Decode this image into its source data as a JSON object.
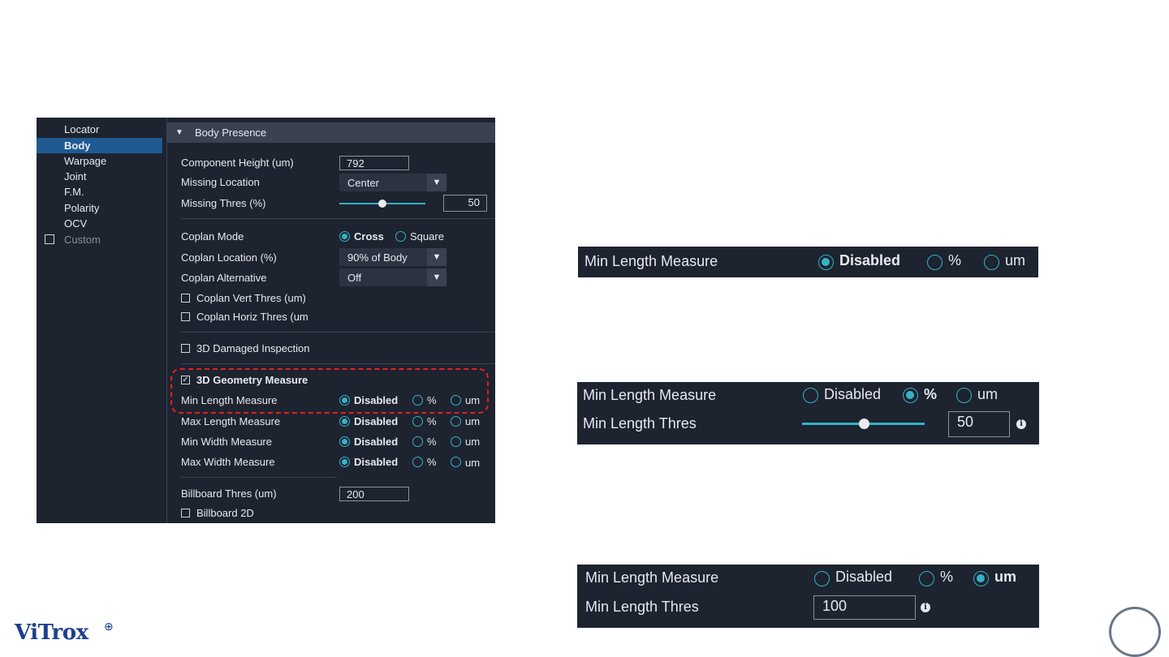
{
  "sidebar": {
    "items": [
      {
        "label": "Locator"
      },
      {
        "label": "Body"
      },
      {
        "label": "Warpage"
      },
      {
        "label": "Joint"
      },
      {
        "label": "F.M."
      },
      {
        "label": "Polarity"
      },
      {
        "label": "OCV"
      },
      {
        "label": "Custom"
      }
    ]
  },
  "section": {
    "title": "Body Presence"
  },
  "fields": {
    "component_height": {
      "label": "Component Height (um)",
      "value": "792"
    },
    "missing_location": {
      "label": "Missing Location",
      "value": "Center"
    },
    "missing_thres": {
      "label": "Missing Thres (%)",
      "value": "50",
      "level": 0.5
    },
    "coplan_mode": {
      "label": "Coplan Mode",
      "opt1": "Cross",
      "opt2": "Square"
    },
    "coplan_location": {
      "label": "Coplan Location (%)",
      "value": "90% of Body"
    },
    "coplan_alternative": {
      "label": "Coplan Alternative",
      "value": "Off"
    },
    "coplan_vert": {
      "label": "Coplan Vert Thres (um)"
    },
    "coplan_horiz": {
      "label": "Coplan Horiz Thres (um"
    },
    "damaged": {
      "label": "3D Damaged Inspection"
    },
    "geometry": {
      "label": "3D Geometry Measure",
      "check": "✓"
    },
    "min_length": {
      "label": "Min Length Measure"
    },
    "max_length": {
      "label": "Max Length Measure"
    },
    "min_width": {
      "label": "Min Width Measure"
    },
    "max_width": {
      "label": "Max Width Measure"
    },
    "billboard_thres": {
      "label": "Billboard Thres (um)",
      "value": "200"
    },
    "billboard_2d": {
      "label": "Billboard 2D"
    }
  },
  "radio_opts": {
    "disabled": "Disabled",
    "percent": "%",
    "um": "um"
  },
  "strip1": {
    "label": "Min Length Measure",
    "opt1": "Disabled",
    "opt2": "%",
    "opt3": "um"
  },
  "strip2": {
    "label": "Min Length Measure",
    "opt1": "Disabled",
    "opt2": "%",
    "opt3": "um",
    "thres_label": "Min Length Thres",
    "thres_value": "50",
    "level": 0.5
  },
  "strip3": {
    "label": "Min Length Measure",
    "opt1": "Disabled",
    "opt2": "%",
    "opt3": "um",
    "thres_label": "Min Length Thres",
    "thres_value": "100"
  },
  "icons": {
    "info": "i",
    "dropdown": "▼",
    "collapse": "▼"
  },
  "brand": {
    "logo": "ViTrox",
    "mark": "⊕"
  },
  "colors": {
    "accent": "#34b3c4",
    "panel": "#1e2330",
    "highlight": "#1f5a93",
    "dashed": "#e02020"
  }
}
